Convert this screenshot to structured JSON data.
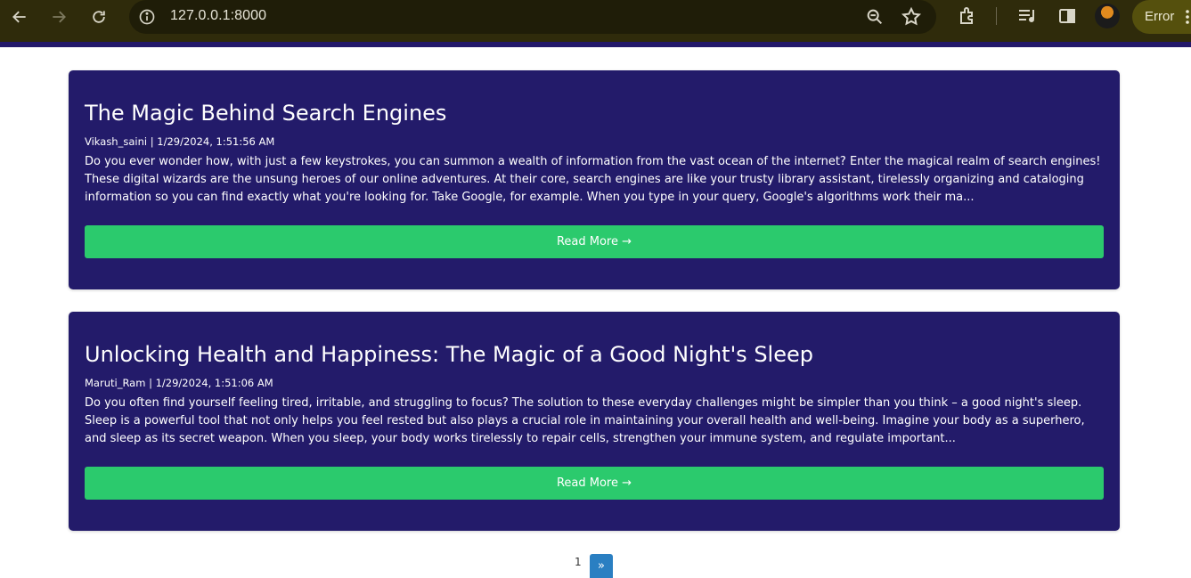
{
  "browser": {
    "url": "127.0.0.1:8000",
    "error_label": "Error"
  },
  "posts": [
    {
      "title": "The Magic Behind Search Engines",
      "meta": "Vikash_saini | 1/29/2024, 1:51:56 AM",
      "excerpt": "Do you ever wonder how, with just a few keystrokes, you can summon a wealth of information from the vast ocean of the internet? Enter the magical realm of search engines! These digital wizards are the unsung heroes of our online adventures. At their core, search engines are like your trusty library assistant, tirelessly organizing and cataloging information so you can find exactly what you're looking for. Take Google, for example. When you type in your query, Google's algorithms work their ma...",
      "read_more": "Read More →"
    },
    {
      "title": "Unlocking Health and Happiness: The Magic of a Good Night's Sleep",
      "meta": "Maruti_Ram | 1/29/2024, 1:51:06 AM",
      "excerpt": "Do you often find yourself feeling tired, irritable, and struggling to focus? The solution to these everyday challenges might be simpler than you think – a good night's sleep. Sleep is a powerful tool that not only helps you feel rested but also plays a crucial role in maintaining your overall health and well-being. Imagine your body as a superhero, and sleep as its secret weapon. When you sleep, your body works tirelessly to repair cells, strengthen your immune system, and regulate important...",
      "read_more": "Read More →"
    }
  ],
  "pagination": {
    "current": "1",
    "next": "»"
  }
}
